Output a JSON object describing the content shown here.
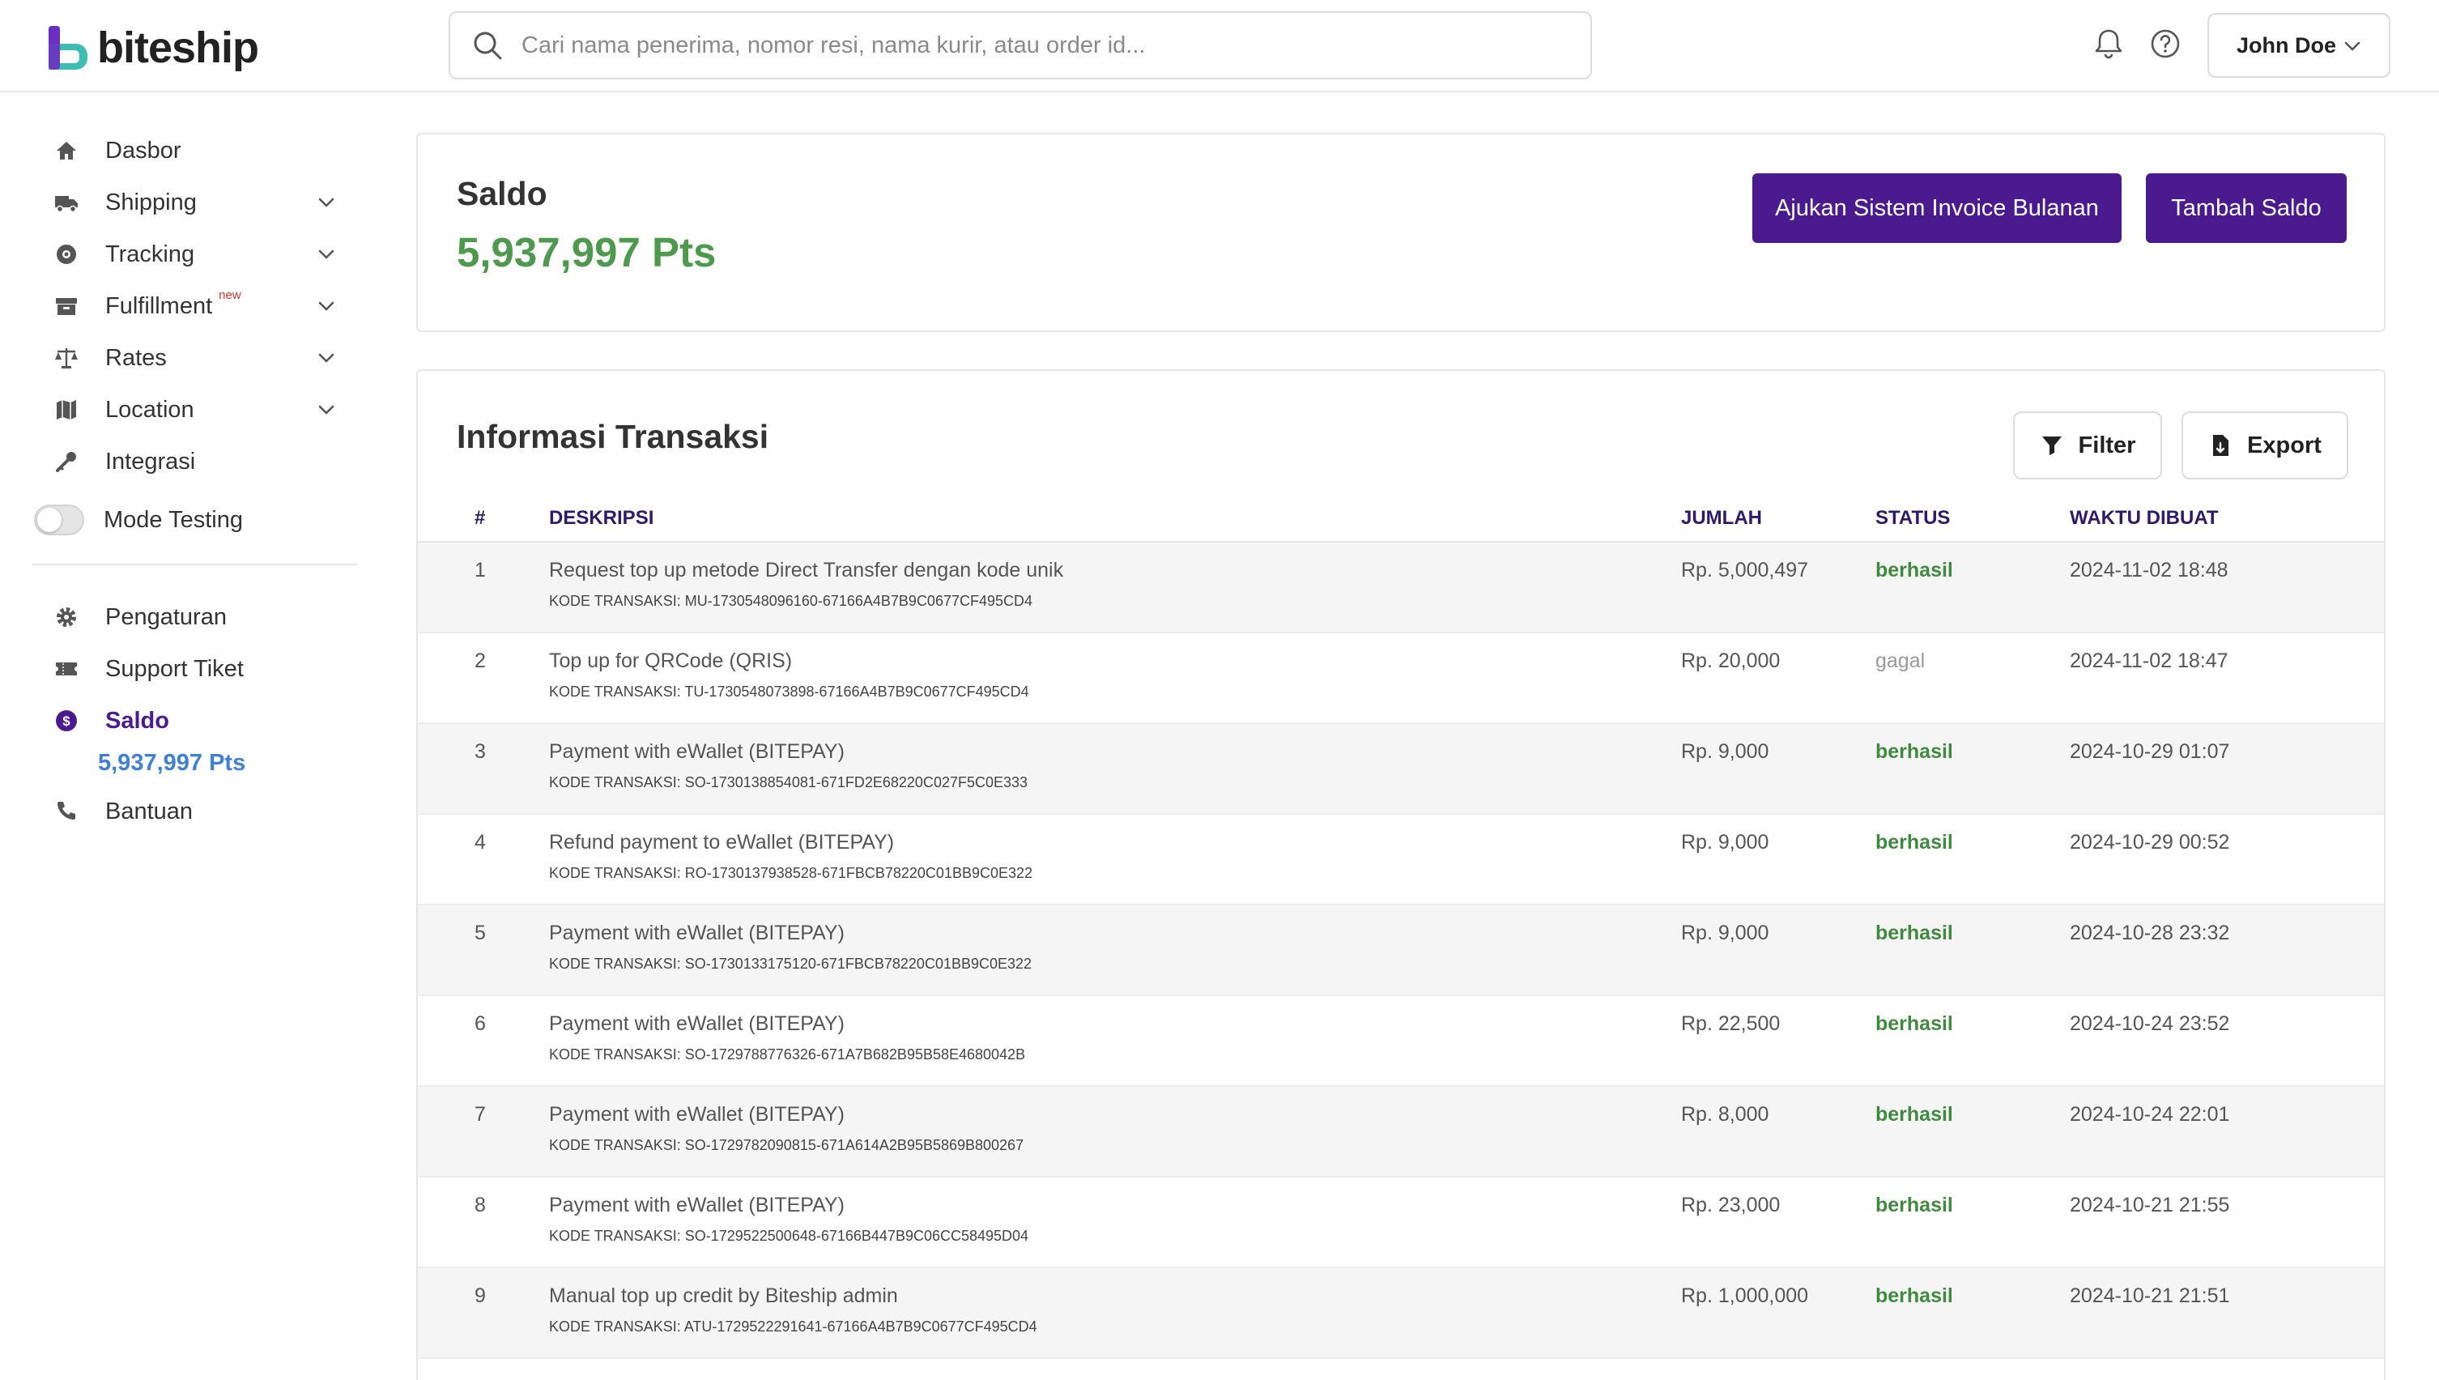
{
  "header": {
    "brand": "biteship",
    "search_placeholder": "Cari nama penerima, nomor resi, nama kurir, atau order id...",
    "user_name": "John Doe"
  },
  "sidebar": {
    "items": [
      {
        "label": "Dasbor",
        "icon": "home-icon"
      },
      {
        "label": "Shipping",
        "icon": "truck-icon",
        "expandable": true
      },
      {
        "label": "Tracking",
        "icon": "tracking-icon",
        "expandable": true
      },
      {
        "label": "Fulfillment",
        "icon": "archive-icon",
        "badge": "new",
        "expandable": true
      },
      {
        "label": "Rates",
        "icon": "scale-icon",
        "expandable": true
      },
      {
        "label": "Location",
        "icon": "map-icon",
        "expandable": true
      },
      {
        "label": "Integrasi",
        "icon": "key-icon"
      },
      {
        "label": "Mode Testing",
        "icon": "toggle-switch"
      },
      {
        "label": "Pengaturan",
        "icon": "gear-icon"
      },
      {
        "label": "Support Tiket",
        "icon": "ticket-icon"
      },
      {
        "label": "Saldo",
        "icon": "dollar-icon",
        "active": true
      },
      {
        "label": "Bantuan",
        "icon": "phone-icon"
      }
    ],
    "balance": "5,937,997 Pts"
  },
  "saldo": {
    "title": "Saldo",
    "value": "5,937,997 Pts",
    "invoice_button": "Ajukan Sistem Invoice Bulanan",
    "topup_button": "Tambah Saldo"
  },
  "transactions": {
    "title": "Informasi Transaksi",
    "filter_label": "Filter",
    "export_label": "Export",
    "columns": [
      "#",
      "DESKRIPSI",
      "JUMLAH",
      "STATUS",
      "WAKTU DIBUAT"
    ],
    "rows": [
      {
        "num": "1",
        "desc": "Request top up metode Direct Transfer dengan kode unik",
        "code": "KODE TRANSAKSI: MU-1730548096160-67166A4B7B9C0677CF495CD4",
        "amount": "Rp. 5,000,497",
        "status": "berhasil",
        "time": "2024-11-02 18:48"
      },
      {
        "num": "2",
        "desc": "Top up for QRCode (QRIS)",
        "code": "KODE TRANSAKSI: TU-1730548073898-67166A4B7B9C0677CF495CD4",
        "amount": "Rp. 20,000",
        "status": "gagal",
        "time": "2024-11-02 18:47"
      },
      {
        "num": "3",
        "desc": "Payment with eWallet (BITEPAY)",
        "code": "KODE TRANSAKSI: SO-1730138854081-671FD2E68220C027F5C0E333",
        "amount": "Rp. 9,000",
        "status": "berhasil",
        "time": "2024-10-29 01:07"
      },
      {
        "num": "4",
        "desc": "Refund payment to eWallet (BITEPAY)",
        "code": "KODE TRANSAKSI: RO-1730137938528-671FBCB78220C01BB9C0E322",
        "amount": "Rp. 9,000",
        "status": "berhasil",
        "time": "2024-10-29 00:52"
      },
      {
        "num": "5",
        "desc": "Payment with eWallet (BITEPAY)",
        "code": "KODE TRANSAKSI: SO-1730133175120-671FBCB78220C01BB9C0E322",
        "amount": "Rp. 9,000",
        "status": "berhasil",
        "time": "2024-10-28 23:32"
      },
      {
        "num": "6",
        "desc": "Payment with eWallet (BITEPAY)",
        "code": "KODE TRANSAKSI: SO-1729788776326-671A7B682B95B58E4680042B",
        "amount": "Rp. 22,500",
        "status": "berhasil",
        "time": "2024-10-24 23:52"
      },
      {
        "num": "7",
        "desc": "Payment with eWallet (BITEPAY)",
        "code": "KODE TRANSAKSI: SO-1729782090815-671A614A2B95B5869B800267",
        "amount": "Rp. 8,000",
        "status": "berhasil",
        "time": "2024-10-24 22:01"
      },
      {
        "num": "8",
        "desc": "Payment with eWallet (BITEPAY)",
        "code": "KODE TRANSAKSI: SO-1729522500648-67166B447B9C06CC58495D04",
        "amount": "Rp. 23,000",
        "status": "berhasil",
        "time": "2024-10-21 21:55"
      },
      {
        "num": "9",
        "desc": "Manual top up credit by Biteship admin",
        "code": "KODE TRANSAKSI: ATU-1729522291641-67166A4B7B9C0677CF495CD4",
        "amount": "Rp. 1,000,000",
        "status": "berhasil",
        "time": "2024-10-21 21:51"
      }
    ]
  },
  "colors": {
    "brand_purple": "#4b1a8f",
    "success_green": "#4d9a4f",
    "balance_blue": "#3d80d4"
  }
}
